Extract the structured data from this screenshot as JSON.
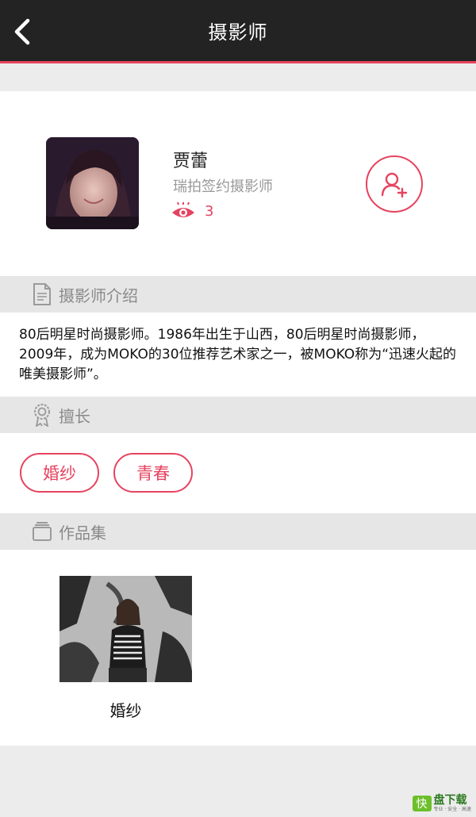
{
  "header": {
    "title": "摄影师"
  },
  "profile": {
    "name": "贾蕾",
    "subtitle": "瑞拍签约摄影师",
    "views": "3"
  },
  "intro": {
    "section_label": "摄影师介绍",
    "text": "80后明星时尚摄影师。1986年出生于山西，80后明星时尚摄影师，2009年，成为MOKO的30位推荐艺术家之一，被MOKO称为“迅速火起的唯美摄影师”。"
  },
  "skills": {
    "section_label": "擅长",
    "tags": [
      "婚纱",
      "青春"
    ]
  },
  "portfolio": {
    "section_label": "作品集",
    "items": [
      {
        "title": "婚纱"
      }
    ]
  },
  "watermark": {
    "main": "盘下载",
    "logo": "快",
    "sub": "专业 · 安全 · 高速"
  },
  "colors": {
    "accent": "#e6435f",
    "topbar": "#232323"
  }
}
